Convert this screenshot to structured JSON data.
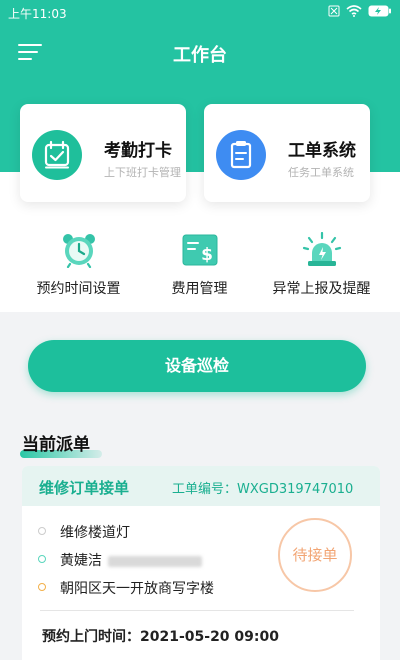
{
  "status_bar": {
    "time": "上午11:03",
    "icons": [
      "sim-x-icon",
      "wifi-icon",
      "battery-icon"
    ]
  },
  "header": {
    "title": "工作台",
    "menu_icon": "hamburger-menu-icon"
  },
  "feature_cards": [
    {
      "title": "考勤打卡",
      "subtitle": "上下班打卡管理",
      "icon": "calendar-check-icon",
      "color": "#1fbf9b"
    },
    {
      "title": "工单系统",
      "subtitle": "任务工单系统",
      "icon": "clipboard-icon",
      "color": "#3e8cf2"
    }
  ],
  "quick_actions": [
    {
      "label": "预约时间设置",
      "icon": "alarm-clock-icon"
    },
    {
      "label": "费用管理",
      "icon": "bill-dollar-icon"
    },
    {
      "label": "异常上报及提醒",
      "icon": "warning-light-icon"
    }
  ],
  "patrol_button": {
    "label": "设备巡检"
  },
  "current_orders": {
    "section_title": "当前派单",
    "order": {
      "type": "维修订单接单",
      "number_label": "工单编号：",
      "number": "WXGD319747010",
      "item": "维修楼道灯",
      "customer": "黄婕洁",
      "address": "朝阳区天一开放商写字楼",
      "status": "待接单",
      "appointment_label": "预约上门时间：",
      "appointment_time": "2021-05-20 09:00"
    }
  },
  "colors": {
    "primary": "#24c3a2",
    "blue": "#3e8cf2",
    "stamp": "#f2a574"
  }
}
